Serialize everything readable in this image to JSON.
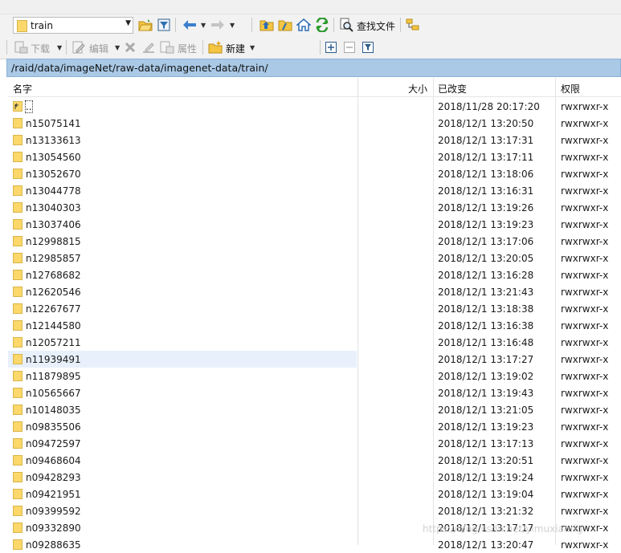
{
  "toolbar1": {
    "location": "train",
    "find_files_label": "查找文件"
  },
  "toolbar2": {
    "download_label": "下载",
    "edit_label": "编辑",
    "properties_label": "属性",
    "new_label": "新建"
  },
  "path": "/raid/data/imageNet/raw-data/imagenet-data/train/",
  "columns": {
    "name": "名字",
    "size": "大小",
    "modified": "已改变",
    "permissions": "权限"
  },
  "rows": [
    {
      "name": "..",
      "date": "2018/11/28 20:17:20",
      "perm": "rwxrwxr-x",
      "up": true
    },
    {
      "name": "n15075141",
      "date": "2018/12/1 13:20:50",
      "perm": "rwxrwxr-x"
    },
    {
      "name": "n13133613",
      "date": "2018/12/1 13:17:31",
      "perm": "rwxrwxr-x"
    },
    {
      "name": "n13054560",
      "date": "2018/12/1 13:17:11",
      "perm": "rwxrwxr-x"
    },
    {
      "name": "n13052670",
      "date": "2018/12/1 13:18:06",
      "perm": "rwxrwxr-x"
    },
    {
      "name": "n13044778",
      "date": "2018/12/1 13:16:31",
      "perm": "rwxrwxr-x"
    },
    {
      "name": "n13040303",
      "date": "2018/12/1 13:19:26",
      "perm": "rwxrwxr-x"
    },
    {
      "name": "n13037406",
      "date": "2018/12/1 13:19:23",
      "perm": "rwxrwxr-x"
    },
    {
      "name": "n12998815",
      "date": "2018/12/1 13:17:06",
      "perm": "rwxrwxr-x"
    },
    {
      "name": "n12985857",
      "date": "2018/12/1 13:20:05",
      "perm": "rwxrwxr-x"
    },
    {
      "name": "n12768682",
      "date": "2018/12/1 13:16:28",
      "perm": "rwxrwxr-x"
    },
    {
      "name": "n12620546",
      "date": "2018/12/1 13:21:43",
      "perm": "rwxrwxr-x"
    },
    {
      "name": "n12267677",
      "date": "2018/12/1 13:18:38",
      "perm": "rwxrwxr-x"
    },
    {
      "name": "n12144580",
      "date": "2018/12/1 13:16:38",
      "perm": "rwxrwxr-x"
    },
    {
      "name": "n12057211",
      "date": "2018/12/1 13:16:48",
      "perm": "rwxrwxr-x"
    },
    {
      "name": "n11939491",
      "date": "2018/12/1 13:17:27",
      "perm": "rwxrwxr-x",
      "selected": true
    },
    {
      "name": "n11879895",
      "date": "2018/12/1 13:19:02",
      "perm": "rwxrwxr-x"
    },
    {
      "name": "n10565667",
      "date": "2018/12/1 13:19:43",
      "perm": "rwxrwxr-x"
    },
    {
      "name": "n10148035",
      "date": "2018/12/1 13:21:05",
      "perm": "rwxrwxr-x"
    },
    {
      "name": "n09835506",
      "date": "2018/12/1 13:19:23",
      "perm": "rwxrwxr-x"
    },
    {
      "name": "n09472597",
      "date": "2018/12/1 13:17:13",
      "perm": "rwxrwxr-x"
    },
    {
      "name": "n09468604",
      "date": "2018/12/1 13:20:51",
      "perm": "rwxrwxr-x"
    },
    {
      "name": "n09428293",
      "date": "2018/12/1 13:19:24",
      "perm": "rwxrwxr-x"
    },
    {
      "name": "n09421951",
      "date": "2018/12/1 13:19:04",
      "perm": "rwxrwxr-x"
    },
    {
      "name": "n09399592",
      "date": "2018/12/1 13:21:32",
      "perm": "rwxrwxr-x"
    },
    {
      "name": "n09332890",
      "date": "2018/12/1 13:17:17",
      "perm": "rwxrwxr-x"
    },
    {
      "name": "n09288635",
      "date": "2018/12/1 13:20:47",
      "perm": "rwxrwxr-x"
    }
  ],
  "watermark": "https://blog.csdn.net/yimuxianrig",
  "colors": {
    "path_bar": "#a9c9e6",
    "selection": "#e8f1fb",
    "folder": "#fcd86a"
  }
}
